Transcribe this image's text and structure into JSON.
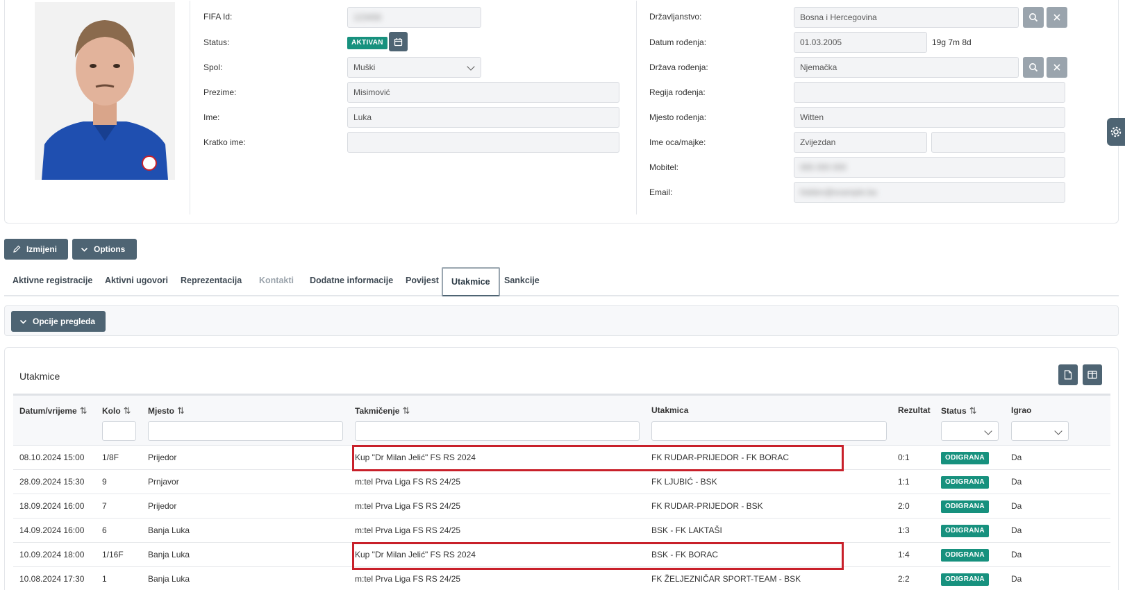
{
  "profile": {
    "fifa_id_label": "FIFA Id:",
    "fifa_id_value": "123456",
    "status_label": "Status:",
    "status_badge": "AKTIVAN",
    "gender_label": "Spol:",
    "gender_value": "Muški",
    "surname_label": "Prezime:",
    "surname_value": "Misimović",
    "name_label": "Ime:",
    "name_value": "Luka",
    "short_name_label": "Kratko ime:",
    "short_name_value": "",
    "citizenship_label": "Državljanstvo:",
    "citizenship_value": "Bosna i Hercegovina",
    "dob_label": "Datum rođenja:",
    "dob_value": "01.03.2005",
    "age_text": "19g 7m 8d",
    "birth_country_label": "Država rođenja:",
    "birth_country_value": "Njemačka",
    "birth_region_label": "Regija rođenja:",
    "birth_region_value": "",
    "birth_place_label": "Mjesto rođenja:",
    "birth_place_value": "Witten",
    "parent_label": "Ime oca/majke:",
    "father_value": "Zvijezdan",
    "mother_value": "",
    "mobile_label": "Mobitel:",
    "mobile_value": "065 000 000",
    "email_label": "Email:",
    "email_value": "hidden@example.ba"
  },
  "actions": {
    "edit_label": "Izmijeni",
    "options_label": "Options"
  },
  "tabs": [
    {
      "label": "Aktivne registracije"
    },
    {
      "label": "Aktivni ugovori"
    },
    {
      "label": "Reprezentacija"
    },
    {
      "label": "Kontakti"
    },
    {
      "label": "Dodatne informacije"
    },
    {
      "label": "Povijest"
    },
    {
      "label": "Utakmice"
    },
    {
      "label": "Sankcije"
    }
  ],
  "view_options_label": "Opcije pregleda",
  "table": {
    "title": "Utakmice",
    "columns": {
      "datetime": "Datum/vrijeme",
      "round": "Kolo",
      "place": "Mjesto",
      "competition": "Takmičenje",
      "match": "Utakmica",
      "result": "Rezultat",
      "status": "Status",
      "played": "Igrao"
    },
    "rows": [
      {
        "datetime": "08.10.2024 15:00",
        "round": "1/8F",
        "place": "Prijedor",
        "competition": "Kup \"Dr Milan Jelić\" FS RS 2024",
        "match": "FK RUDAR-PRIJEDOR - FK BORAC",
        "result": "0:1",
        "status": "ODIGRANA",
        "played": "Da"
      },
      {
        "datetime": "28.09.2024 15:30",
        "round": "9",
        "place": "Prnjavor",
        "competition": "m:tel Prva Liga FS RS 24/25",
        "match": "FK LJUBIĆ - BSK",
        "result": "1:1",
        "status": "ODIGRANA",
        "played": "Da"
      },
      {
        "datetime": "18.09.2024 16:00",
        "round": "7",
        "place": "Prijedor",
        "competition": "m:tel Prva Liga FS RS 24/25",
        "match": "FK RUDAR-PRIJEDOR - BSK",
        "result": "2:0",
        "status": "ODIGRANA",
        "played": "Da"
      },
      {
        "datetime": "14.09.2024 16:00",
        "round": "6",
        "place": "Banja Luka",
        "competition": "m:tel Prva Liga FS RS 24/25",
        "match": "BSK - FK LAKTAŠI",
        "result": "1:3",
        "status": "ODIGRANA",
        "played": "Da"
      },
      {
        "datetime": "10.09.2024 18:00",
        "round": "1/16F",
        "place": "Banja Luka",
        "competition": "Kup \"Dr Milan Jelić\" FS RS 2024",
        "match": "BSK - FK BORAC",
        "result": "1:4",
        "status": "ODIGRANA",
        "played": "Da"
      },
      {
        "datetime": "10.08.2024 17:30",
        "round": "1",
        "place": "Banja Luka",
        "competition": "m:tel Prva Liga FS RS 24/25",
        "match": "FK ŽELJEZNIČAR SPORT-TEAM - BSK",
        "result": "2:2",
        "status": "ODIGRANA",
        "played": "Da"
      }
    ]
  },
  "colors": {
    "primary": "#4e6473",
    "success": "#17917e",
    "highlight": "#c8202a"
  }
}
